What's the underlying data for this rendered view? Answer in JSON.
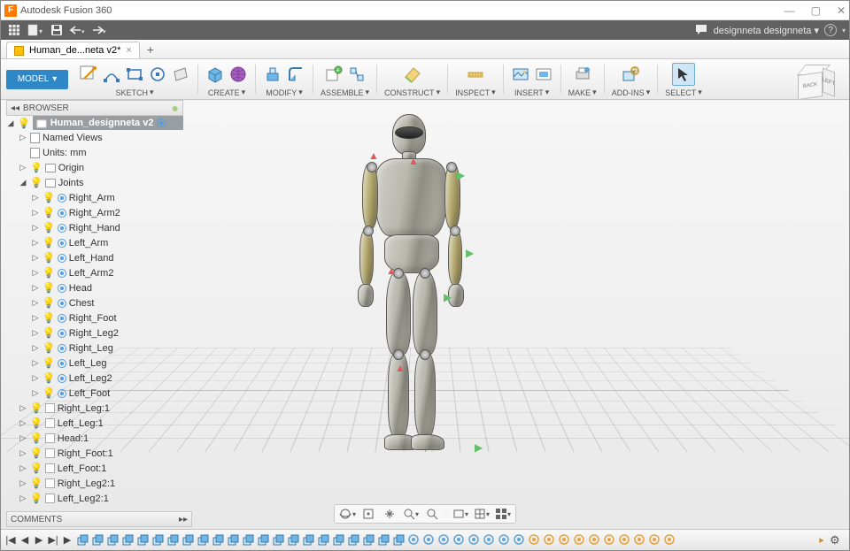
{
  "titlebar": {
    "app_letter": "F",
    "title": "Autodesk Fusion 360",
    "min": "—",
    "max": "▢",
    "close": "✕"
  },
  "qat": {
    "user_label": "designneta designneta",
    "help": "?"
  },
  "filetab": {
    "name": "Human_de...neta v2*",
    "close": "×",
    "plus": "+"
  },
  "workspace": {
    "label": "MODEL",
    "caret": "▾"
  },
  "ribbon": {
    "sketch": "SKETCH",
    "create": "CREATE",
    "modify": "MODIFY",
    "assemble": "ASSEMBLE",
    "construct": "CONSTRUCT",
    "inspect": "INSPECT",
    "insert": "INSERT",
    "make": "MAKE",
    "addins": "ADD-INS",
    "select": "SELECT",
    "caret": "▾"
  },
  "viewcube": {
    "front": "BACK",
    "side": "LEFT"
  },
  "browser": {
    "header": "BROWSER",
    "collapse": "◂◂",
    "root": "Human_designneta v2",
    "named_views": "Named Views",
    "units": "Units: mm",
    "origin": "Origin",
    "joints": "Joints",
    "joint_items": [
      "Right_Arm",
      "Right_Arm2",
      "Right_Hand",
      "Left_Arm",
      "Left_Hand",
      "Left_Arm2",
      "Head",
      "Chest",
      "Right_Foot",
      "Right_Leg2",
      "Right_Leg",
      "Left_Leg",
      "Left_Leg2",
      "Left_Foot"
    ],
    "bodies": [
      "Right_Leg:1",
      "Left_Leg:1",
      "Head:1",
      "Right_Foot:1",
      "Left_Foot:1",
      "Right_Leg2:1",
      "Left_Leg2:1"
    ]
  },
  "comments": {
    "label": "COMMENTS",
    "arrow": "▸▸"
  },
  "viewnav": {
    "b0": "⟲",
    "b1": "✋",
    "b2": "🔍",
    "b3": "⤢",
    "b4": "🔍",
    "sep": "·",
    "b5": "▦",
    "b6": "▦",
    "b7": "▦"
  },
  "timeline": {
    "controls": [
      "|◀",
      "◀",
      "▶",
      "▶|",
      "▶"
    ]
  }
}
